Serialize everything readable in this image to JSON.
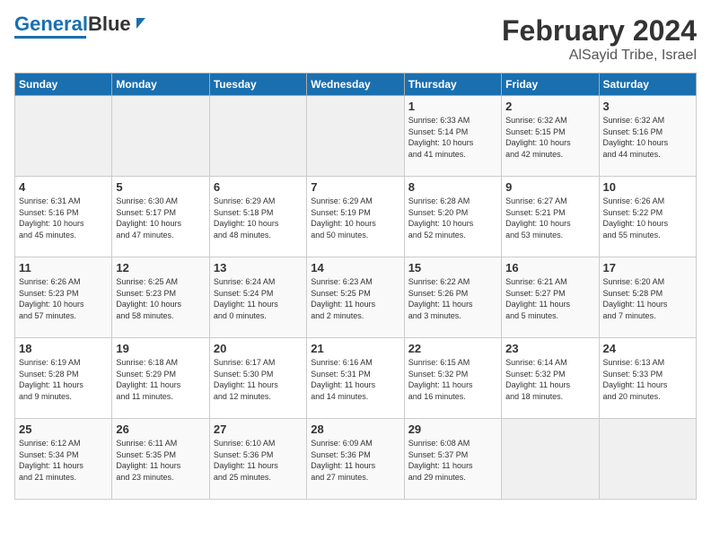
{
  "logo": {
    "line1": "General",
    "line2": "Blue"
  },
  "title": "February 2024",
  "subtitle": "AlSayid Tribe, Israel",
  "days_of_week": [
    "Sunday",
    "Monday",
    "Tuesday",
    "Wednesday",
    "Thursday",
    "Friday",
    "Saturday"
  ],
  "weeks": [
    [
      {
        "num": "",
        "info": ""
      },
      {
        "num": "",
        "info": ""
      },
      {
        "num": "",
        "info": ""
      },
      {
        "num": "",
        "info": ""
      },
      {
        "num": "1",
        "info": "Sunrise: 6:33 AM\nSunset: 5:14 PM\nDaylight: 10 hours\nand 41 minutes."
      },
      {
        "num": "2",
        "info": "Sunrise: 6:32 AM\nSunset: 5:15 PM\nDaylight: 10 hours\nand 42 minutes."
      },
      {
        "num": "3",
        "info": "Sunrise: 6:32 AM\nSunset: 5:16 PM\nDaylight: 10 hours\nand 44 minutes."
      }
    ],
    [
      {
        "num": "4",
        "info": "Sunrise: 6:31 AM\nSunset: 5:16 PM\nDaylight: 10 hours\nand 45 minutes."
      },
      {
        "num": "5",
        "info": "Sunrise: 6:30 AM\nSunset: 5:17 PM\nDaylight: 10 hours\nand 47 minutes."
      },
      {
        "num": "6",
        "info": "Sunrise: 6:29 AM\nSunset: 5:18 PM\nDaylight: 10 hours\nand 48 minutes."
      },
      {
        "num": "7",
        "info": "Sunrise: 6:29 AM\nSunset: 5:19 PM\nDaylight: 10 hours\nand 50 minutes."
      },
      {
        "num": "8",
        "info": "Sunrise: 6:28 AM\nSunset: 5:20 PM\nDaylight: 10 hours\nand 52 minutes."
      },
      {
        "num": "9",
        "info": "Sunrise: 6:27 AM\nSunset: 5:21 PM\nDaylight: 10 hours\nand 53 minutes."
      },
      {
        "num": "10",
        "info": "Sunrise: 6:26 AM\nSunset: 5:22 PM\nDaylight: 10 hours\nand 55 minutes."
      }
    ],
    [
      {
        "num": "11",
        "info": "Sunrise: 6:26 AM\nSunset: 5:23 PM\nDaylight: 10 hours\nand 57 minutes."
      },
      {
        "num": "12",
        "info": "Sunrise: 6:25 AM\nSunset: 5:23 PM\nDaylight: 10 hours\nand 58 minutes."
      },
      {
        "num": "13",
        "info": "Sunrise: 6:24 AM\nSunset: 5:24 PM\nDaylight: 11 hours\nand 0 minutes."
      },
      {
        "num": "14",
        "info": "Sunrise: 6:23 AM\nSunset: 5:25 PM\nDaylight: 11 hours\nand 2 minutes."
      },
      {
        "num": "15",
        "info": "Sunrise: 6:22 AM\nSunset: 5:26 PM\nDaylight: 11 hours\nand 3 minutes."
      },
      {
        "num": "16",
        "info": "Sunrise: 6:21 AM\nSunset: 5:27 PM\nDaylight: 11 hours\nand 5 minutes."
      },
      {
        "num": "17",
        "info": "Sunrise: 6:20 AM\nSunset: 5:28 PM\nDaylight: 11 hours\nand 7 minutes."
      }
    ],
    [
      {
        "num": "18",
        "info": "Sunrise: 6:19 AM\nSunset: 5:28 PM\nDaylight: 11 hours\nand 9 minutes."
      },
      {
        "num": "19",
        "info": "Sunrise: 6:18 AM\nSunset: 5:29 PM\nDaylight: 11 hours\nand 11 minutes."
      },
      {
        "num": "20",
        "info": "Sunrise: 6:17 AM\nSunset: 5:30 PM\nDaylight: 11 hours\nand 12 minutes."
      },
      {
        "num": "21",
        "info": "Sunrise: 6:16 AM\nSunset: 5:31 PM\nDaylight: 11 hours\nand 14 minutes."
      },
      {
        "num": "22",
        "info": "Sunrise: 6:15 AM\nSunset: 5:32 PM\nDaylight: 11 hours\nand 16 minutes."
      },
      {
        "num": "23",
        "info": "Sunrise: 6:14 AM\nSunset: 5:32 PM\nDaylight: 11 hours\nand 18 minutes."
      },
      {
        "num": "24",
        "info": "Sunrise: 6:13 AM\nSunset: 5:33 PM\nDaylight: 11 hours\nand 20 minutes."
      }
    ],
    [
      {
        "num": "25",
        "info": "Sunrise: 6:12 AM\nSunset: 5:34 PM\nDaylight: 11 hours\nand 21 minutes."
      },
      {
        "num": "26",
        "info": "Sunrise: 6:11 AM\nSunset: 5:35 PM\nDaylight: 11 hours\nand 23 minutes."
      },
      {
        "num": "27",
        "info": "Sunrise: 6:10 AM\nSunset: 5:36 PM\nDaylight: 11 hours\nand 25 minutes."
      },
      {
        "num": "28",
        "info": "Sunrise: 6:09 AM\nSunset: 5:36 PM\nDaylight: 11 hours\nand 27 minutes."
      },
      {
        "num": "29",
        "info": "Sunrise: 6:08 AM\nSunset: 5:37 PM\nDaylight: 11 hours\nand 29 minutes."
      },
      {
        "num": "",
        "info": ""
      },
      {
        "num": "",
        "info": ""
      }
    ]
  ]
}
